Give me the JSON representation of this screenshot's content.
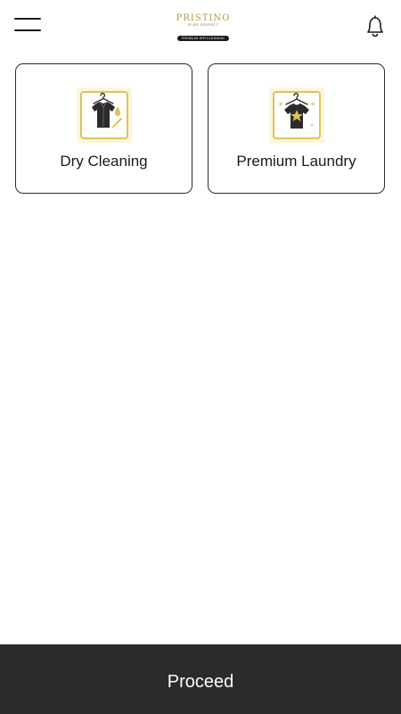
{
  "header": {
    "menu_icon": "hamburger-menu-icon",
    "logo": {
      "brand": "PRISTINO",
      "tagline": "PURE PERFECT",
      "badge": "PREMIUM DRYCLEANING"
    },
    "notification_icon": "bell-icon"
  },
  "services": [
    {
      "label": "Dry Cleaning",
      "icon": "shirt-hanger-drop-icon"
    },
    {
      "label": "Premium Laundry",
      "icon": "tshirt-hanger-star-icon"
    }
  ],
  "footer": {
    "proceed_label": "Proceed"
  },
  "colors": {
    "accent": "#e0c25a",
    "icon_bg": "#fdf6dc",
    "dark": "#2b2b2b"
  }
}
